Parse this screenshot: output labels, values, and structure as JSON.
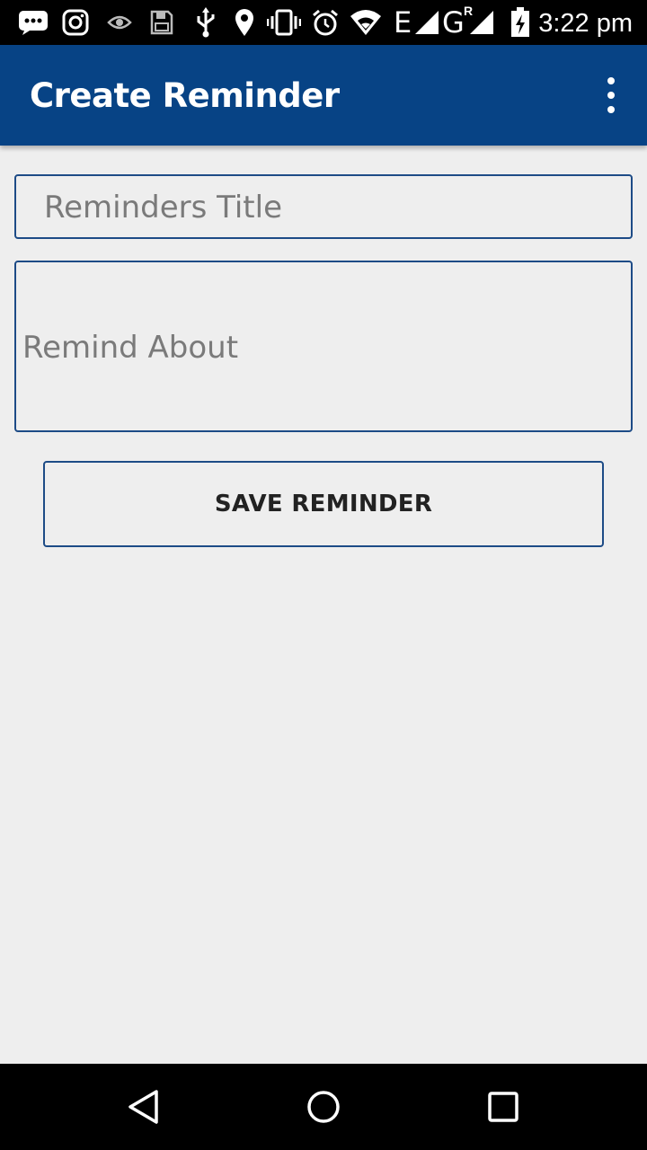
{
  "status_bar": {
    "time": "3:22 pm",
    "network_1": "E",
    "network_2": "G",
    "network_2_sup": "R",
    "icons": [
      "message-icon",
      "instagram-icon",
      "eye-icon",
      "save-icon",
      "usb-icon",
      "location-icon",
      "vibrate-icon",
      "alarm-icon",
      "wifi-icon",
      "signal-icon",
      "signal-icon",
      "battery-charging-icon"
    ]
  },
  "app_bar": {
    "title": "Create Reminder",
    "menu_icon": "more-vert-icon"
  },
  "form": {
    "title_placeholder": "Reminders Title",
    "title_value": "",
    "about_placeholder": "Remind About",
    "about_value": "",
    "save_label": "SAVE REMINDER"
  },
  "nav_bar": {
    "icons": [
      "back-icon",
      "home-icon",
      "recents-icon"
    ]
  },
  "colors": {
    "app_bar": "#074385",
    "field_border": "#1d4b86",
    "background": "#eeeeee",
    "placeholder": "#7a7a7a"
  }
}
